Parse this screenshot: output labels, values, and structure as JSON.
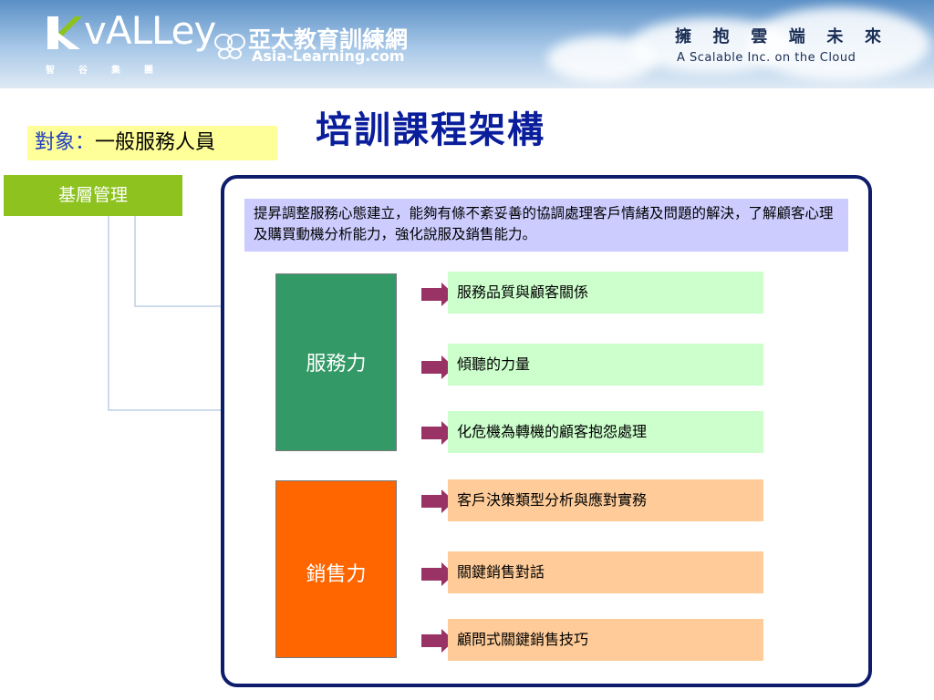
{
  "header": {
    "logo_text": "vALLey",
    "logo_sub": "智谷集團",
    "brand_cn": "亞太教育訓練網",
    "brand_en": "Asia-Learning.com",
    "slogan_cn": [
      "擁",
      "抱",
      "雲",
      "端",
      "未",
      "來"
    ],
    "slogan_en": "A Scalable Inc. on the Cloud"
  },
  "title": "培訓課程架構",
  "audience": {
    "label": "對象：",
    "value": "一般服務人員"
  },
  "level": "基層管理",
  "description": "提昇調整服務心態建立，能夠有條不紊妥善的協調處理客戶情緒及問題的解決，了解顧客心理及購買動機分析能力，強化說服及銷售能力。",
  "categories": [
    {
      "name": "服務力",
      "items": [
        "服務品質與顧客關係",
        "傾聽的力量",
        "化危機為轉機的顧客抱怨處理"
      ]
    },
    {
      "name": "銷售力",
      "items": [
        "客戶決策類型分析與應對實務",
        "關鍵銷售對話",
        "顧問式關鍵銷售技巧"
      ]
    }
  ],
  "colors": {
    "title": "#0a1e9c",
    "service": "#339966",
    "sales": "#ff6600",
    "service_item": "#ccffcc",
    "sales_item": "#ffcc99",
    "description_bg": "#ccccff",
    "level_tag": "#8dc21f",
    "arrow": "#993366"
  }
}
